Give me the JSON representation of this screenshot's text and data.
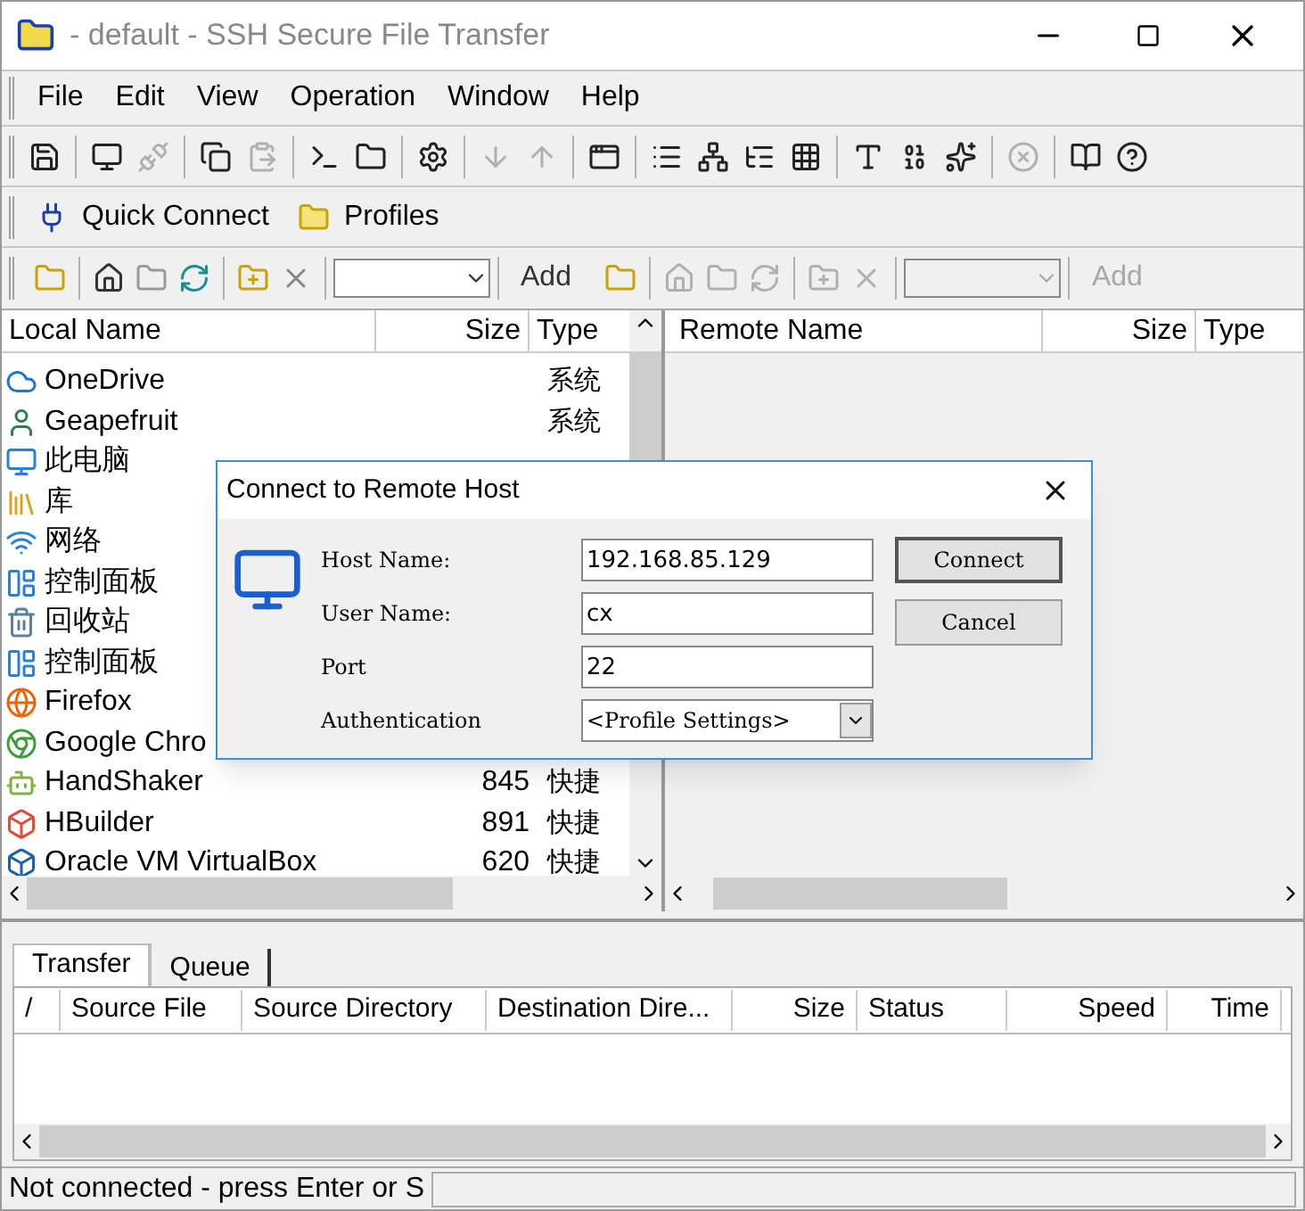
{
  "window": {
    "title": "- default - SSH Secure File Transfer"
  },
  "menu": [
    "File",
    "Edit",
    "View",
    "Operation",
    "Window",
    "Help"
  ],
  "toolbar": [
    {
      "kind": "save",
      "disabled": false
    },
    {
      "kind": "computer",
      "disabled": false
    },
    {
      "kind": "disconnect",
      "disabled": true
    },
    {
      "kind": "copy",
      "disabled": false
    },
    {
      "kind": "paste",
      "disabled": true
    },
    {
      "kind": "terminal",
      "disabled": false
    },
    {
      "kind": "folder",
      "disabled": false
    },
    {
      "kind": "settings",
      "disabled": false
    },
    {
      "kind": "download",
      "disabled": true
    },
    {
      "kind": "upload",
      "disabled": true
    },
    {
      "kind": "window",
      "disabled": false
    },
    {
      "kind": "list",
      "disabled": false
    },
    {
      "kind": "tree",
      "disabled": false
    },
    {
      "kind": "details",
      "disabled": false
    },
    {
      "kind": "grid",
      "disabled": false
    },
    {
      "kind": "ascii",
      "disabled": false
    },
    {
      "kind": "binary",
      "disabled": false
    },
    {
      "kind": "auto",
      "disabled": false
    },
    {
      "kind": "stop",
      "disabled": true
    },
    {
      "kind": "help",
      "disabled": false
    },
    {
      "kind": "whatsthis",
      "disabled": false
    }
  ],
  "quick_bar": [
    {
      "label": "Quick Connect",
      "kind": "connect"
    },
    {
      "label": "Profiles",
      "kind": "folder"
    }
  ],
  "local_toolbar": {
    "add": "Add",
    "disabled": false
  },
  "remote_toolbar": {
    "add": "Add",
    "disabled": true
  },
  "local_pane": {
    "columns": [
      "Local Name",
      "Size",
      "Type"
    ],
    "rows": [
      {
        "name": "OneDrive",
        "size": "",
        "type": "系统",
        "kind": "cloud"
      },
      {
        "name": "Geapefruit",
        "size": "",
        "type": "系统",
        "kind": "user"
      },
      {
        "name": "此电脑",
        "size": "",
        "type": "",
        "kind": "pc"
      },
      {
        "name": "库",
        "size": "",
        "type": "",
        "kind": "library"
      },
      {
        "name": "网络",
        "size": "",
        "type": "",
        "kind": "network"
      },
      {
        "name": "控制面板",
        "size": "",
        "type": "",
        "kind": "panel"
      },
      {
        "name": "回收站",
        "size": "",
        "type": "",
        "kind": "bin"
      },
      {
        "name": "控制面板",
        "size": "",
        "type": "",
        "kind": "panel"
      },
      {
        "name": "Firefox",
        "size": "",
        "type": "",
        "kind": "firefox"
      },
      {
        "name": "Google Chro",
        "size": "",
        "type": "",
        "kind": "chrome"
      },
      {
        "name": "HandShaker",
        "size": "845",
        "type": "快捷",
        "kind": "android"
      },
      {
        "name": "HBuilder",
        "size": "891",
        "type": "快捷",
        "kind": "hbuilder"
      },
      {
        "name": "Oracle VM VirtualBox",
        "size": "620",
        "type": "快捷",
        "kind": "box"
      }
    ]
  },
  "remote_pane": {
    "columns": [
      "Remote Name",
      "Size",
      "Type"
    ]
  },
  "dialog": {
    "title": "Connect to Remote Host",
    "fields": [
      {
        "label": "Host Name:",
        "value": "192.168.85.129",
        "kind": "text"
      },
      {
        "label": "User Name:",
        "value": "cx",
        "kind": "text"
      },
      {
        "label": "Port",
        "value": "22",
        "kind": "text"
      },
      {
        "label": "Authentication",
        "value": "<Profile Settings>",
        "kind": "select"
      }
    ],
    "buttons": [
      "Connect",
      "Cancel"
    ]
  },
  "transfer": {
    "tabs": [
      {
        "label": "Transfer",
        "selected": true
      },
      {
        "label": "Queue",
        "selected": false
      }
    ],
    "columns": [
      "/",
      "Source File",
      "Source Directory",
      "Destination Dire...",
      "Size",
      "Status",
      "Speed",
      "Time"
    ]
  },
  "status_bar": "Not connected - press Enter or S"
}
